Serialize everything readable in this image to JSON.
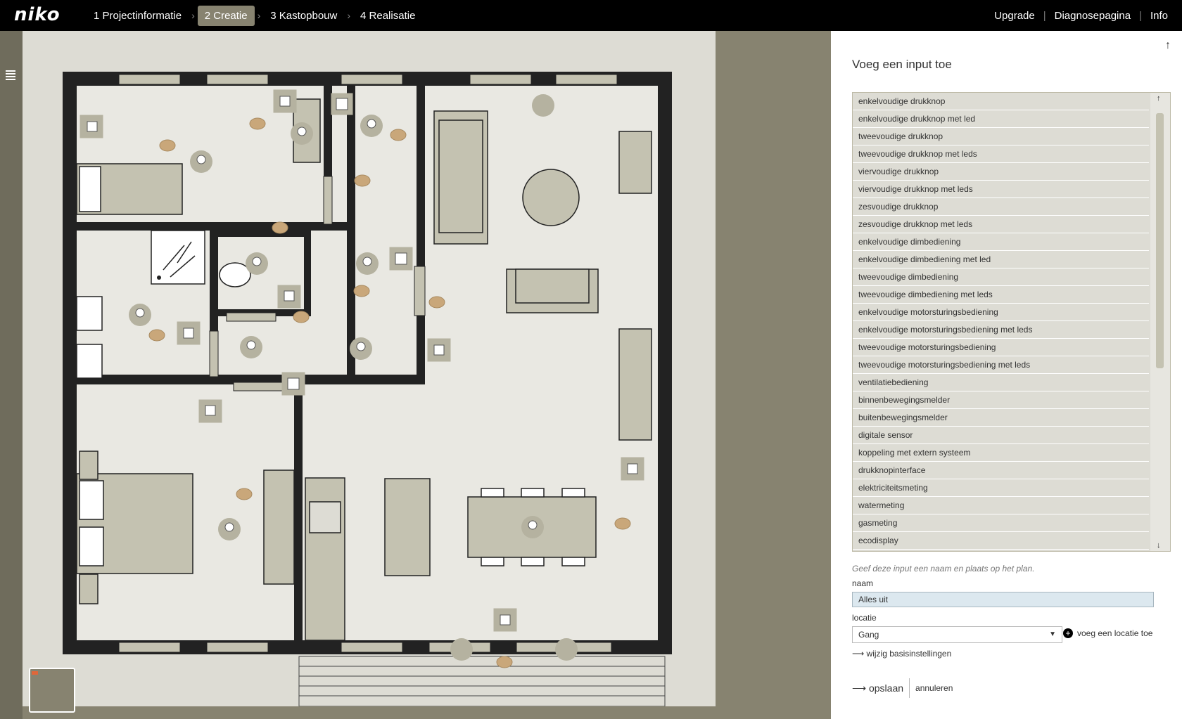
{
  "app": {
    "logo": "niko"
  },
  "steps": [
    {
      "label": "1 Projectinformatie",
      "active": false
    },
    {
      "label": "2 Creatie",
      "active": true
    },
    {
      "label": "3 Kastopbouw",
      "active": false
    },
    {
      "label": "4 Realisatie",
      "active": false
    }
  ],
  "topright": {
    "upgrade": "Upgrade",
    "diagnose": "Diagnosepagina",
    "info": "Info"
  },
  "panel": {
    "title": "Voeg een input toe",
    "items": [
      "enkelvoudige drukknop",
      "enkelvoudige drukknop met led",
      "tweevoudige drukknop",
      "tweevoudige drukknop met leds",
      "viervoudige drukknop",
      "viervoudige drukknop met leds",
      "zesvoudige drukknop",
      "zesvoudige drukknop met leds",
      "enkelvoudige dimbediening",
      "enkelvoudige dimbediening met led",
      "tweevoudige dimbediening",
      "tweevoudige dimbediening met leds",
      "enkelvoudige motorsturingsbediening",
      "enkelvoudige motorsturingsbediening met leds",
      "tweevoudige motorsturingsbediening",
      "tweevoudige motorsturingsbediening met leds",
      "ventilatiebediening",
      "binnenbewegingsmelder",
      "buitenbewegingsmelder",
      "digitale sensor",
      "koppeling met extern systeem",
      "drukknopinterface",
      "elektriciteitsmeting",
      "watermeting",
      "gasmeting",
      "ecodisplay"
    ],
    "hint": "Geef deze input een naam en plaats op het plan.",
    "naam_label": "naam",
    "naam_value": "Alles uit",
    "locatie_label": "locatie",
    "locatie_value": "Gang",
    "add_location": "voeg een locatie toe",
    "wijzig": "wijzig basisinstellingen",
    "save": "opslaan",
    "cancel": "annuleren"
  },
  "colors": {
    "topbar": "#000000",
    "accent": "#878370",
    "bubble": "#c9a77a",
    "wall": "#222222"
  }
}
